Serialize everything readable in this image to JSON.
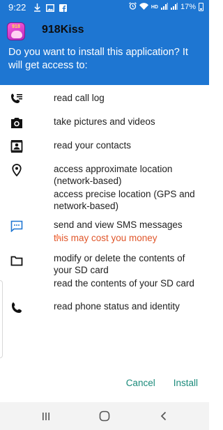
{
  "status_bar": {
    "time": "9:22",
    "network_badge": "HD",
    "battery": "17%",
    "left_icons": [
      "download-icon",
      "image-icon",
      "facebook-icon"
    ],
    "right_icons": [
      "alarm-icon",
      "wifi-icon",
      "hd-badge",
      "signal-icon",
      "signal-icon",
      "battery-icon"
    ]
  },
  "header": {
    "app_icon_text": "918",
    "app_name": "918Kiss",
    "prompt": "Do you want to install this application? It will get access to:",
    "bg_color": "#1e76d2"
  },
  "permissions": [
    {
      "icon": "call-log-icon",
      "lines": [
        "read call log"
      ]
    },
    {
      "icon": "camera-icon",
      "lines": [
        "take pictures and videos"
      ]
    },
    {
      "icon": "contacts-icon",
      "lines": [
        "read your contacts"
      ]
    },
    {
      "icon": "location-icon",
      "lines": [
        "access approximate location (network-based)",
        "access precise location (GPS and network-based)"
      ]
    },
    {
      "icon": "sms-icon",
      "lines": [
        "send and view SMS messages"
      ],
      "warning": "this may cost you money"
    },
    {
      "icon": "folder-icon",
      "lines": [
        "modify or delete the contents of your SD card",
        "read the contents of your SD card"
      ]
    },
    {
      "icon": "phone-icon",
      "lines": [
        "read phone status and identity"
      ]
    }
  ],
  "actions": {
    "cancel": "Cancel",
    "install": "Install",
    "color": "#1a8a7a"
  },
  "nav_bar": {
    "buttons": [
      "recents-icon",
      "home-icon",
      "back-icon"
    ]
  },
  "colors": {
    "accent": "#1e76d2",
    "warning": "#e0562a",
    "sms_icon": "#1e76d2"
  }
}
